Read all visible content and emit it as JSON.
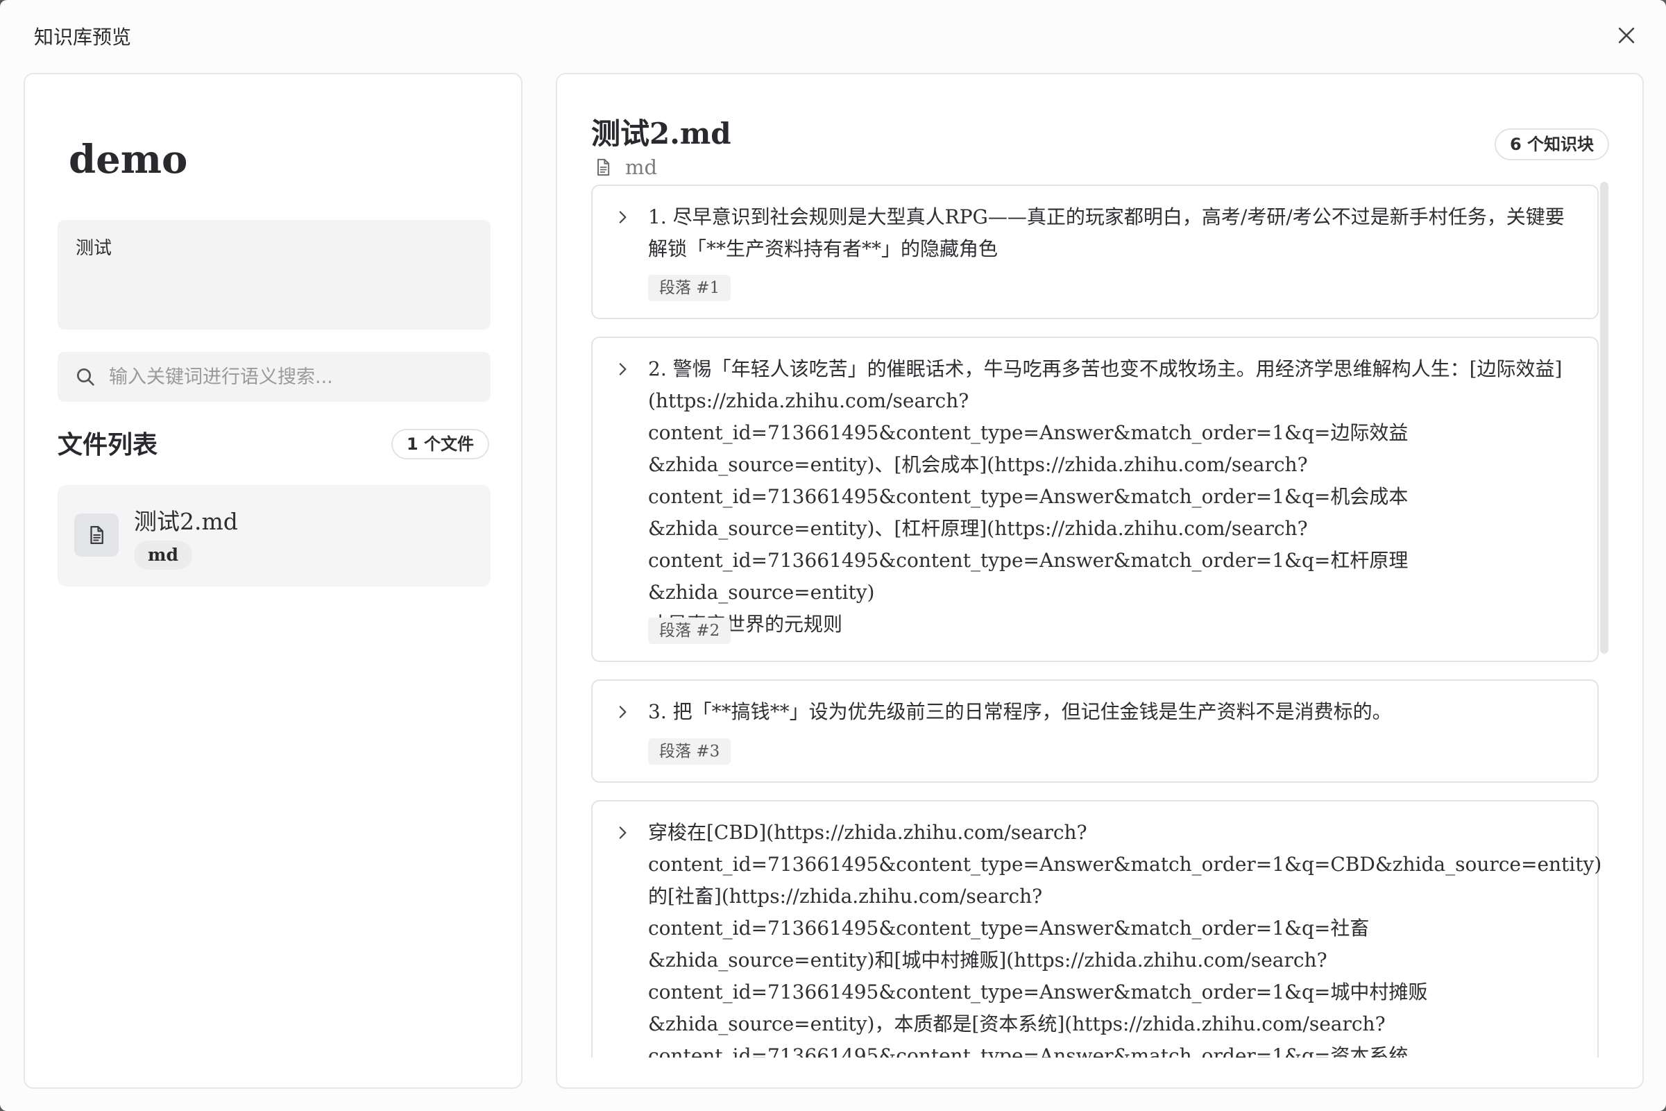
{
  "dialog": {
    "title": "知识库预览",
    "close_icon": "close-icon"
  },
  "left": {
    "kb_name": "demo",
    "description": "测试",
    "search_placeholder": "输入关键词进行语义搜索...",
    "file_list_title": "文件列表",
    "file_count": "1 个文件",
    "files": [
      {
        "name": "测试2.md",
        "type": "md",
        "icon": "document-icon"
      }
    ]
  },
  "right": {
    "doc_title": "测试2.md",
    "doc_type": "md",
    "chunk_count": "6 个知识块",
    "chunks": [
      {
        "text": "1. 尽早意识到社会规则是大型真人RPG——真正的玩家都明白，高考/考研/考公不过是新手村任务，关键要解锁「**生产资料持有者**」的隐藏角色",
        "tag": "段落 #1"
      },
      {
        "text": "2. 警惕「年轻人该吃苦」的催眠话术，牛马吃再多苦也变不成牧场主。用经济学思维解构人生：[边际效益](https://zhida.zhihu.com/search?\ncontent_id=713661495&content_type=Answer&match_order=1&q=边际效益\n&zhida_source=entity)、[机会成本](https://zhida.zhihu.com/search?\ncontent_id=713661495&content_type=Answer&match_order=1&q=机会成本\n&zhida_source=entity)、[杠杆原理](https://zhida.zhihu.com/search?\ncontent_id=713661495&content_type=Answer&match_order=1&q=杠杆原理&zhida_source=entity)\n才是真实世界的元规则",
        "tag": "段落 #2"
      },
      {
        "text": "3. 把「**搞钱**」设为优先级前三的日常程序，但记住金钱是生产资料不是消费标的。",
        "tag": "段落 #3"
      },
      {
        "text": "穿梭在[CBD](https://zhida.zhihu.com/search?\ncontent_id=713661495&content_type=Answer&match_order=1&q=CBD&zhida_source=entity)的[社畜](https://zhida.zhihu.com/search?\ncontent_id=713661495&content_type=Answer&match_order=1&q=社畜&zhida_source=entity)和[城中村摊贩](https://zhida.zhihu.com/search?\ncontent_id=713661495&content_type=Answer&match_order=1&q=城中村摊贩\n&zhida_source=entity)，本质都是[资本系统](https://zhida.zhihu.com/search?\ncontent_id=713661495&content_type=Answer&match_order=1&q=资本系统&zhida_source=entity)",
        "tag": ""
      }
    ]
  }
}
